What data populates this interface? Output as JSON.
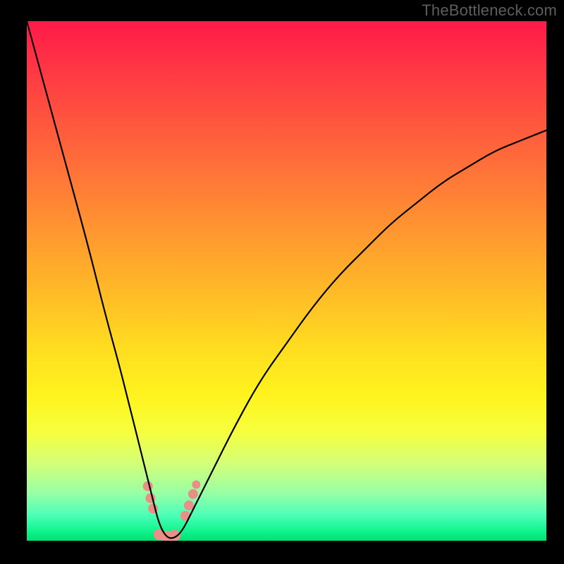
{
  "watermark": "TheBottleneck.com",
  "chart_data": {
    "type": "line",
    "title": "",
    "xlabel": "",
    "ylabel": "",
    "xlim": [
      0,
      1
    ],
    "ylim": [
      0,
      1
    ],
    "description": "V-shaped bottleneck curve over red-to-green vertical gradient; minimum near x≈0.27 touching y≈0. Left branch starts at top-left corner and descends steeply. Right branch rises with diminishing slope toward upper-right at y≈0.79. Small salmon blobs cluster around the trough.",
    "series": [
      {
        "name": "curve",
        "x": [
          0.0,
          0.03,
          0.06,
          0.09,
          0.12,
          0.15,
          0.18,
          0.2,
          0.22,
          0.24,
          0.255,
          0.27,
          0.285,
          0.3,
          0.32,
          0.35,
          0.4,
          0.45,
          0.5,
          0.55,
          0.6,
          0.65,
          0.7,
          0.75,
          0.8,
          0.85,
          0.9,
          0.95,
          1.0
        ],
        "y": [
          1.0,
          0.89,
          0.78,
          0.67,
          0.56,
          0.44,
          0.33,
          0.25,
          0.17,
          0.09,
          0.03,
          0.005,
          0.005,
          0.02,
          0.06,
          0.12,
          0.22,
          0.31,
          0.38,
          0.45,
          0.51,
          0.56,
          0.61,
          0.65,
          0.69,
          0.72,
          0.75,
          0.77,
          0.79
        ]
      }
    ],
    "markers": [
      {
        "x": 0.233,
        "y": 0.105,
        "r": 7
      },
      {
        "x": 0.238,
        "y": 0.082,
        "r": 7
      },
      {
        "x": 0.243,
        "y": 0.062,
        "r": 7
      },
      {
        "x": 0.255,
        "y": 0.012,
        "r": 8
      },
      {
        "x": 0.27,
        "y": 0.007,
        "r": 9
      },
      {
        "x": 0.285,
        "y": 0.01,
        "r": 8
      },
      {
        "x": 0.305,
        "y": 0.048,
        "r": 7
      },
      {
        "x": 0.312,
        "y": 0.068,
        "r": 7
      },
      {
        "x": 0.32,
        "y": 0.09,
        "r": 7
      },
      {
        "x": 0.326,
        "y": 0.108,
        "r": 6
      }
    ],
    "gradient_stops": [
      {
        "pos": 0.0,
        "color": "#ff1a49"
      },
      {
        "pos": 0.5,
        "color": "#ffba27"
      },
      {
        "pos": 0.8,
        "color": "#f6ff3d"
      },
      {
        "pos": 1.0,
        "color": "#00e070"
      }
    ]
  }
}
